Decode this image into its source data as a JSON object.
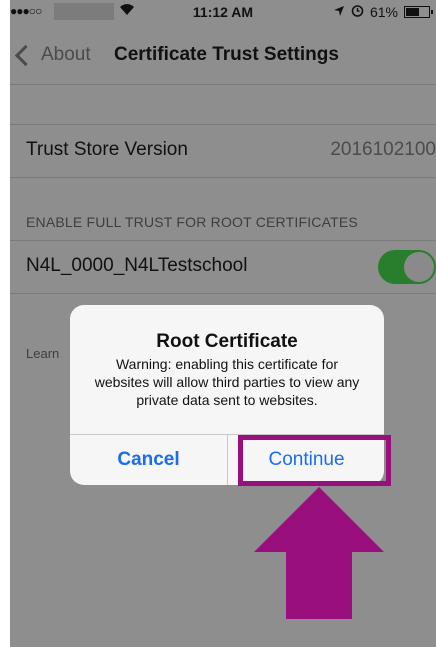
{
  "status_bar": {
    "signal": "●●●○○",
    "time": "11:12 AM",
    "battery": "61%",
    "battery_level": 0.61,
    "icons": [
      "wifi-icon",
      "location-arrow-icon",
      "alarm-icon",
      "battery-icon"
    ]
  },
  "nav": {
    "back_label": "About",
    "title": "Certificate Trust Settings"
  },
  "trust_store": {
    "label": "Trust Store Version",
    "value": "2016102100"
  },
  "section": {
    "header": "ENABLE FULL TRUST FOR ROOT CERTIFICATES"
  },
  "certificate": {
    "name": "N4L_0000_N4LTestschool",
    "enabled": true
  },
  "footer": {
    "learn_text": "Learn"
  },
  "alert": {
    "title": "Root Certificate",
    "message": "Warning: enabling this certificate for websites will allow third parties to view any private data sent to websites.",
    "cancel_label": "Cancel",
    "continue_label": "Continue"
  },
  "colors": {
    "accent": "#1a6cf0",
    "highlight": "#9a0f7e",
    "toggle_on": "#297e2d"
  }
}
